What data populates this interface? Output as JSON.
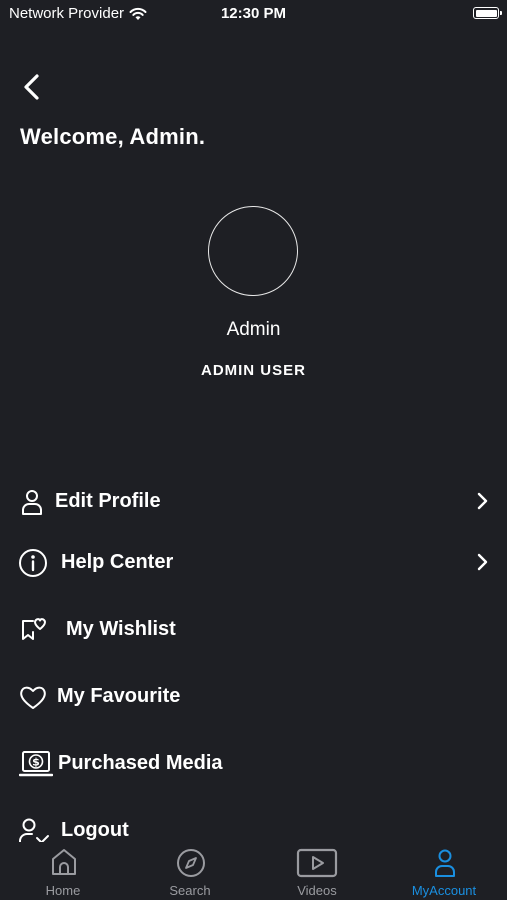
{
  "status_bar": {
    "carrier": "Network Provider",
    "time": "12:30 PM"
  },
  "header": {
    "welcome": "Welcome, Admin."
  },
  "profile": {
    "name": "Admin",
    "role": "ADMIN USER"
  },
  "menu": {
    "items": [
      {
        "label": "Edit Profile",
        "icon": "person-icon"
      },
      {
        "label": "Help Center",
        "icon": "info-icon"
      },
      {
        "label": "My Wishlist",
        "icon": "wishlist-heart-icon"
      },
      {
        "label": "My Favourite",
        "icon": "heart-icon"
      },
      {
        "label": "Purchased Media",
        "icon": "dollar-laptop-icon"
      },
      {
        "label": "Logout",
        "icon": "person-check-icon"
      }
    ]
  },
  "tab_bar": {
    "tabs": [
      {
        "label": "Home",
        "icon": "home-icon"
      },
      {
        "label": "Search",
        "icon": "compass-icon"
      },
      {
        "label": "Videos",
        "icon": "play-icon"
      },
      {
        "label": "MyAccount",
        "icon": "person-icon"
      }
    ],
    "active_index": 3
  },
  "colors": {
    "background": "#1e1f24",
    "accent": "#1a8fe0",
    "inactive": "#9a9ba0",
    "text": "#ffffff"
  }
}
